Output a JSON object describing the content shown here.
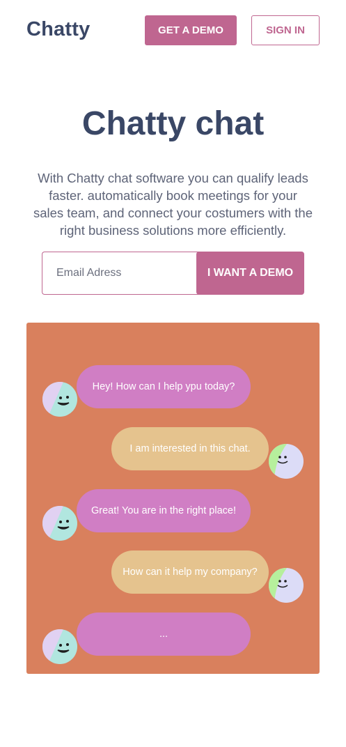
{
  "header": {
    "logo": "Chatty",
    "demo_button": "GET A DEMO",
    "signin_button": "SIGN IN"
  },
  "hero": {
    "title": "Chatty chat",
    "subtitle": "With Chatty chat software you can qualify leads faster. automatically book meetings for your sales team, and connect your costumers with the right business solutions more efficiently."
  },
  "signup": {
    "email_placeholder": "Email Adress",
    "submit_label": "I WANT A DEMO"
  },
  "chat": {
    "messages": [
      {
        "sender": "bot",
        "text": "Hey! How can I help ypu today?"
      },
      {
        "sender": "user",
        "text": "I am interested in this chat."
      },
      {
        "sender": "bot",
        "text": "Great! You are in the right place!"
      },
      {
        "sender": "user",
        "text": "How can it help my company?"
      },
      {
        "sender": "bot",
        "text": "..."
      }
    ]
  },
  "colors": {
    "brand": "#bf6690",
    "heading": "#3a4766",
    "panel": "#d9805d",
    "bot_bubble": "#d07ec4",
    "user_bubble": "#e5c38e"
  }
}
